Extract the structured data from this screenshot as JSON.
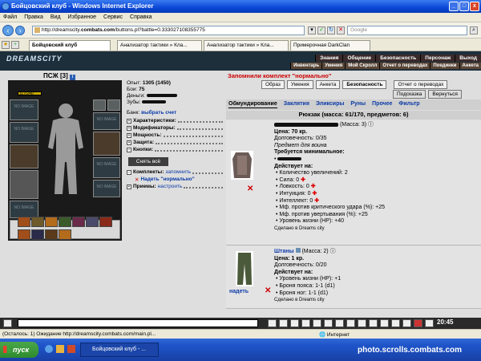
{
  "window": {
    "title": "Бойцовский клуб - Windows Internet Explorer"
  },
  "menu": [
    "Файл",
    "Правка",
    "Вид",
    "Избранное",
    "Сервис",
    "Справка"
  ],
  "address": {
    "url_prefix": "http://dreamscity.",
    "url_domain": "combats.com",
    "url_path": "/buttons.pl?battle=0.333027108355775",
    "search_placeholder": "Google"
  },
  "tabs": [
    {
      "label": "Бойцовский клуб",
      "active": true
    },
    {
      "label": "Анализатор тактики » Кла...",
      "active": false
    },
    {
      "label": "Анализатор тактики » Кла...",
      "active": false
    },
    {
      "label": "Примерочная DarkClan",
      "active": false
    }
  ],
  "game": {
    "logo": "DREAMSCITY",
    "top_nav": [
      "Знания",
      "Общение",
      "Безопасность",
      "Персонаж",
      "Выход"
    ],
    "sub_nav": [
      "Инвентарь",
      "Умения",
      "Мой Скролл",
      "Отчет о переводах",
      "Поединки",
      "Анкета"
    ],
    "character": {
      "name": "ПСЖ",
      "level": "[3]",
      "hp": "117/240"
    },
    "stats": {
      "exp_label": "Опыт:",
      "exp_value": "1305 (1450)",
      "battles_label": "Бои:",
      "battles_value": "75",
      "money_label": "Деньги:",
      "zubs_label": "Зубы:",
      "slot_placeholder": "NO IMAGE"
    },
    "stat_sections": {
      "bank_label": "Банк:",
      "bank_link": "выбрать счет",
      "rows": [
        "Характеристики:",
        "Модификаторы:",
        "Мощность:",
        "Защита:",
        "Кнопки:"
      ],
      "reset_btn": "Снять всё",
      "sets_label": "Комплекты:",
      "sets_link": "запомнить",
      "sets_item": "Надеть \"нормально\"",
      "techniques_label": "Приемы:",
      "techniques_link": "настроить"
    },
    "right": {
      "saved_set": "Запомнили комплект \"нормально\"",
      "buttons": [
        "Образ",
        "Умения",
        "Анкета",
        "Безопасность",
        "Отчет о переводах"
      ],
      "buttons2": [
        "Подсказка",
        "Вернуться"
      ],
      "categories": [
        "Обмундирование",
        "Заклятия",
        "Эликсиры",
        "Руны",
        "Прочее",
        "Фильтр"
      ],
      "backpack": "Рюкзак (масса: 61/170, предметов: 6)"
    },
    "items": [
      {
        "mass": "(Масса: 3)",
        "price": "Цена: 70 кр.",
        "durability": "Долговечность: 0/35",
        "kind": "Предмет для воина",
        "req": "Требуется минимальное:",
        "acts": "Действует на:",
        "bullets": [
          "Количество увеличений: 2",
          "Сила: 0",
          "Ловкость: 0",
          "Интуиция: 0",
          "Интеллект: 0",
          "Мф. против критического удара (%): +25",
          "Мф. против увертывания (%): +25",
          "Уровень жизни (HP): +40"
        ],
        "made": "Сделано в Dreams city"
      },
      {
        "name": "Штаны",
        "mass": "(Масса: 2)",
        "price": "Цена: 1 кр.",
        "durability": "Долговечность: 0/20",
        "acts": "Действует на:",
        "bullets": [
          "Уровень жизни (HP): +1",
          "Броня пояса: 1-1 (d1)",
          "Броня ног: 1-1 (d1)"
        ],
        "made": "Сделано в Dreams city",
        "wear": "надеть"
      }
    ],
    "clock": "20:45"
  },
  "status": {
    "left": "(Осталось: 1) Ожидание http://dreamscity.combats.com/main.pl...",
    "right": "Интернет"
  },
  "taskbar": {
    "start": "пуск",
    "app": "Бойцовский клуб - ...",
    "watermark": "photo.scrolls.combats.com"
  }
}
